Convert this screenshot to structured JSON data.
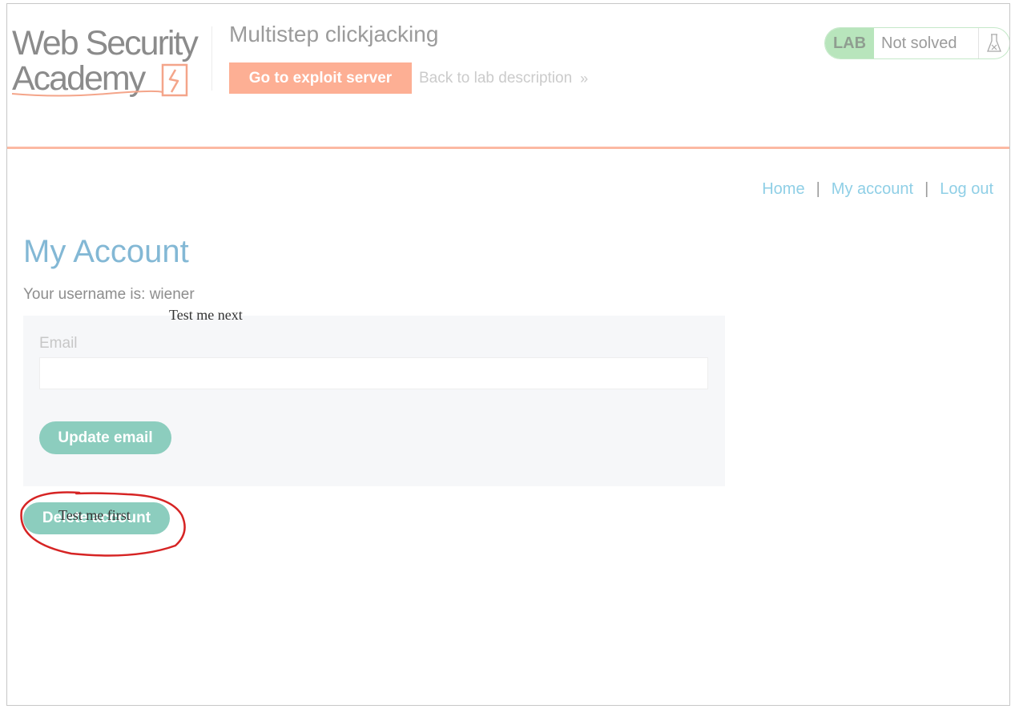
{
  "header": {
    "logo_line1": "Web Security",
    "logo_line2": "Academy",
    "lab_title": "Multistep clickjacking",
    "exploit_button": "Go to exploit server",
    "back_link": "Back to lab description",
    "back_chevron": "»",
    "lab_badge": "LAB",
    "lab_status": "Not solved"
  },
  "nav": {
    "home": "Home",
    "sep": "|",
    "my_account": "My account",
    "log_out": "Log out"
  },
  "main": {
    "title": "My Account",
    "username_line": "Your username is: wiener",
    "email_label": "Email",
    "email_value": "",
    "update_button": "Update email",
    "delete_button": "Delete account"
  },
  "decoys": {
    "next": "Test me next",
    "first": "Test me first"
  },
  "colors": {
    "accent_orange": "#fdaf94",
    "teal_button": "#8ccdbe",
    "link_blue": "#8fcfe6",
    "title_blue": "#83b8d5",
    "annotation_red": "#d62424"
  }
}
